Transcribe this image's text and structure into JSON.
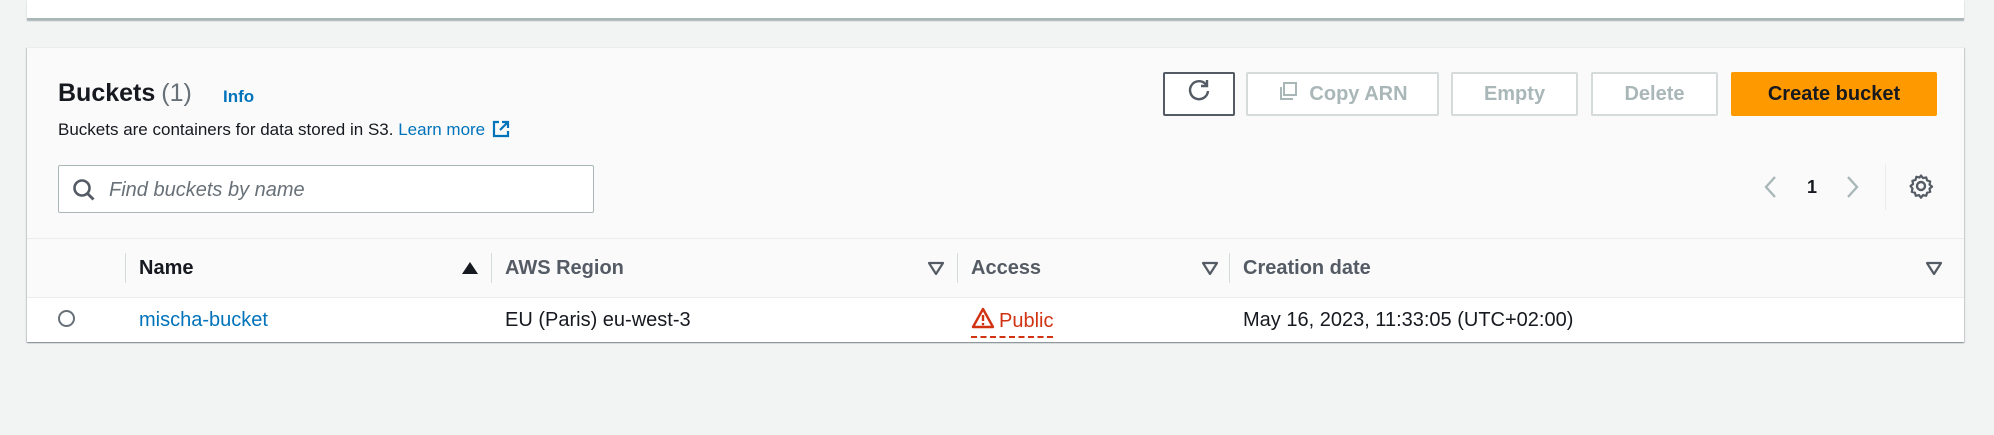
{
  "panel": {
    "title": "Buckets",
    "count": "(1)",
    "info_link": "Info",
    "description": "Buckets are containers for data stored in S3.",
    "learn_more": "Learn more"
  },
  "actions": {
    "copy_arn": "Copy ARN",
    "empty": "Empty",
    "delete": "Delete",
    "create_bucket": "Create bucket"
  },
  "search": {
    "placeholder": "Find buckets by name",
    "value": ""
  },
  "pagination": {
    "current_page": "1"
  },
  "table": {
    "columns": [
      "Name",
      "AWS Region",
      "Access",
      "Creation date"
    ],
    "rows": [
      {
        "name": "mischa-bucket",
        "region": "EU (Paris) eu-west-3",
        "access": "Public",
        "creation_date": "May 16, 2023, 11:33:05 (UTC+02:00)"
      }
    ]
  },
  "colors": {
    "link": "#0073bb",
    "primary_button": "#ff9900",
    "public_warning": "#d13212"
  },
  "icons": [
    "refresh-icon",
    "copy-icon",
    "external-link-icon",
    "search-icon",
    "chevron-left-icon",
    "chevron-right-icon",
    "settings-icon",
    "sort-ascending-icon",
    "sort-icon",
    "warning-icon"
  ]
}
